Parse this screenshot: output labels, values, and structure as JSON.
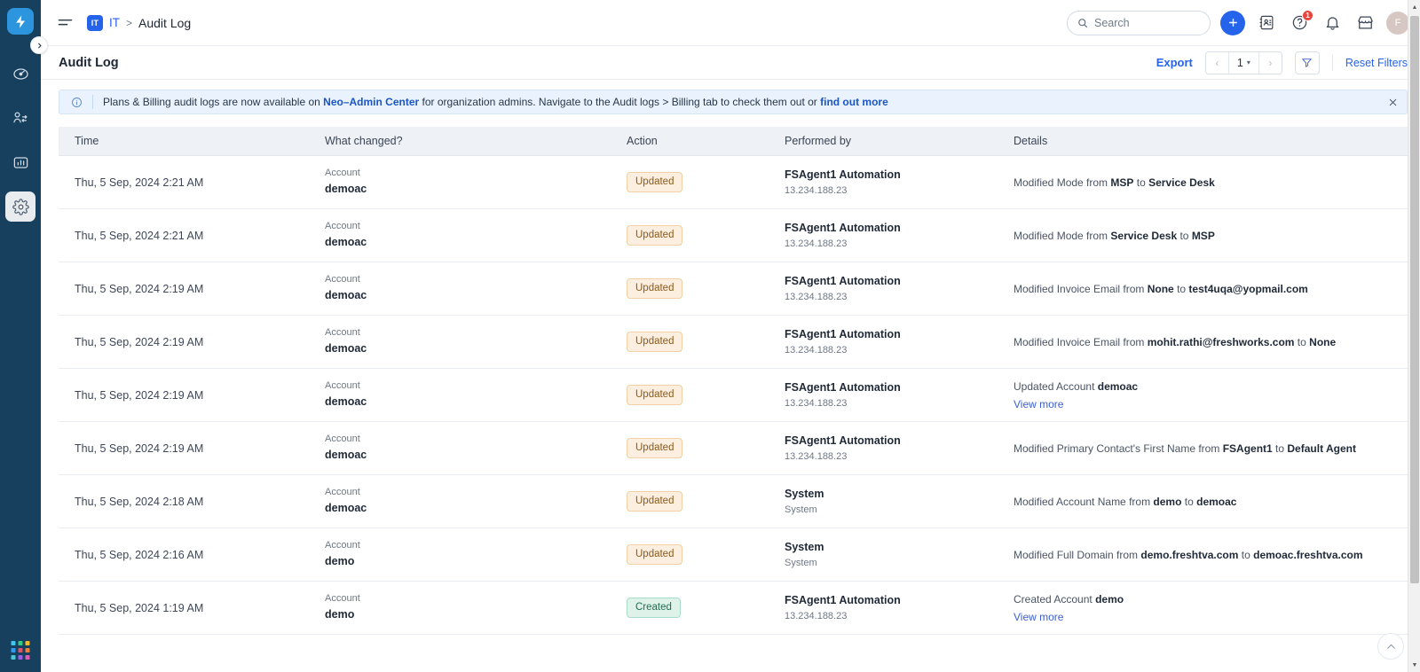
{
  "sidebar": {
    "logo_icon": "lightning-bolt-icon",
    "expand_icon": "chevron-right-icon",
    "items": [
      {
        "name": "dashboard",
        "icon": "speedometer-icon",
        "active": false
      },
      {
        "name": "contacts-swap",
        "icon": "people-swap-icon",
        "active": false
      },
      {
        "name": "analytics",
        "icon": "bar-chart-icon",
        "active": false
      },
      {
        "name": "admin-settings",
        "icon": "gear-icon",
        "active": true
      }
    ],
    "switcher_icon": "app-switcher-icon",
    "switcher_colors": [
      "#3dc6f0",
      "#35c97f",
      "#f5b721",
      "#2d9bf0",
      "#e0556a",
      "#f07f35",
      "#4ac7d6",
      "#9b5de5",
      "#e05cb0"
    ]
  },
  "topbar": {
    "menu_icon": "hamburger-icon",
    "breadcrumb": {
      "badge": "IT",
      "link": "IT",
      "separator": ">",
      "current": "Audit Log"
    },
    "search": {
      "icon": "search-icon",
      "placeholder": "Search",
      "value": ""
    },
    "add_button_icon": "plus-icon",
    "icons": [
      {
        "name": "contacts-icon",
        "badge": ""
      },
      {
        "name": "help-icon",
        "badge": "1"
      },
      {
        "name": "notifications-bell-icon",
        "badge": ""
      },
      {
        "name": "marketplace-icon",
        "badge": ""
      }
    ],
    "avatar": {
      "initial": "F"
    }
  },
  "page": {
    "title": "Audit Log",
    "export_label": "Export",
    "pagination": {
      "prev": "‹",
      "page": "1",
      "next": "›",
      "caret": "▾"
    },
    "filter_icon": "filter-funnel-icon",
    "reset_filters_label": "Reset Filters"
  },
  "banner": {
    "icon": "info-circle-icon",
    "text_1": "Plans & Billing audit logs are now available on ",
    "link_1": "Neo–Admin Center",
    "text_2": " for organization admins. Navigate to the Audit logs > Billing tab to check them out or ",
    "link_2": "find out more",
    "close_icon": "close-icon"
  },
  "table": {
    "headers": [
      "Time",
      "What changed?",
      "Action",
      "Performed by",
      "Details"
    ],
    "rows": [
      {
        "time": "Thu, 5 Sep, 2024 2:21 AM",
        "changed_type": "Account",
        "changed_name": "demoac",
        "action": "Updated",
        "action_kind": "updated",
        "performed_by": "FSAgent1 Automation",
        "performed_ip": "13.234.188.23",
        "details_pre": "Modified Mode from ",
        "details_b1": "MSP",
        "details_mid": " to ",
        "details_b2": "Service Desk",
        "details_post": "",
        "view_more": ""
      },
      {
        "time": "Thu, 5 Sep, 2024 2:21 AM",
        "changed_type": "Account",
        "changed_name": "demoac",
        "action": "Updated",
        "action_kind": "updated",
        "performed_by": "FSAgent1 Automation",
        "performed_ip": "13.234.188.23",
        "details_pre": "Modified Mode from ",
        "details_b1": "Service Desk",
        "details_mid": " to ",
        "details_b2": "MSP",
        "details_post": "",
        "view_more": ""
      },
      {
        "time": "Thu, 5 Sep, 2024 2:19 AM",
        "changed_type": "Account",
        "changed_name": "demoac",
        "action": "Updated",
        "action_kind": "updated",
        "performed_by": "FSAgent1 Automation",
        "performed_ip": "13.234.188.23",
        "details_pre": "Modified Invoice Email from ",
        "details_b1": "None",
        "details_mid": " to ",
        "details_b2": "test4uqa@yopmail.com",
        "details_post": "",
        "view_more": ""
      },
      {
        "time": "Thu, 5 Sep, 2024 2:19 AM",
        "changed_type": "Account",
        "changed_name": "demoac",
        "action": "Updated",
        "action_kind": "updated",
        "performed_by": "FSAgent1 Automation",
        "performed_ip": "13.234.188.23",
        "details_pre": "Modified Invoice Email from ",
        "details_b1": "mohit.rathi@freshworks.com",
        "details_mid": " to ",
        "details_b2": "None",
        "details_post": "",
        "view_more": ""
      },
      {
        "time": "Thu, 5 Sep, 2024 2:19 AM",
        "changed_type": "Account",
        "changed_name": "demoac",
        "action": "Updated",
        "action_kind": "updated",
        "performed_by": "FSAgent1 Automation",
        "performed_ip": "13.234.188.23",
        "details_pre": "Updated Account ",
        "details_b1": "demoac",
        "details_mid": "",
        "details_b2": "",
        "details_post": "",
        "view_more": "View more"
      },
      {
        "time": "Thu, 5 Sep, 2024 2:19 AM",
        "changed_type": "Account",
        "changed_name": "demoac",
        "action": "Updated",
        "action_kind": "updated",
        "performed_by": "FSAgent1 Automation",
        "performed_ip": "13.234.188.23",
        "details_pre": "Modified Primary Contact's First Name from ",
        "details_b1": "FSAgent1",
        "details_mid": " to ",
        "details_b2": "Default Agent",
        "details_post": "",
        "view_more": ""
      },
      {
        "time": "Thu, 5 Sep, 2024 2:18 AM",
        "changed_type": "Account",
        "changed_name": "demoac",
        "action": "Updated",
        "action_kind": "updated",
        "performed_by": "System",
        "performed_ip": "System",
        "details_pre": "Modified Account Name from ",
        "details_b1": "demo",
        "details_mid": " to ",
        "details_b2": "demoac",
        "details_post": "",
        "view_more": ""
      },
      {
        "time": "Thu, 5 Sep, 2024 2:16 AM",
        "changed_type": "Account",
        "changed_name": "demo",
        "action": "Updated",
        "action_kind": "updated",
        "performed_by": "System",
        "performed_ip": "System",
        "details_pre": "Modified Full Domain from ",
        "details_b1": "demo.freshtva.com",
        "details_mid": " to ",
        "details_b2": "demoac.freshtva.com",
        "details_post": "",
        "view_more": ""
      },
      {
        "time": "Thu, 5 Sep, 2024 1:19 AM",
        "changed_type": "Account",
        "changed_name": "demo",
        "action": "Created",
        "action_kind": "created",
        "performed_by": "FSAgent1 Automation",
        "performed_ip": "13.234.188.23",
        "details_pre": "Created Account ",
        "details_b1": "demo",
        "details_mid": "",
        "details_b2": "",
        "details_post": "",
        "view_more": "View more"
      }
    ]
  },
  "scroll_top": {
    "icon": "chevron-up-icon"
  },
  "colors": {
    "rail_bg": "#17405e",
    "accent_blue": "#2563eb",
    "banner_bg": "#eaf3fd",
    "pill_updated_bg": "#fdefdf",
    "pill_created_bg": "#def2ea"
  }
}
